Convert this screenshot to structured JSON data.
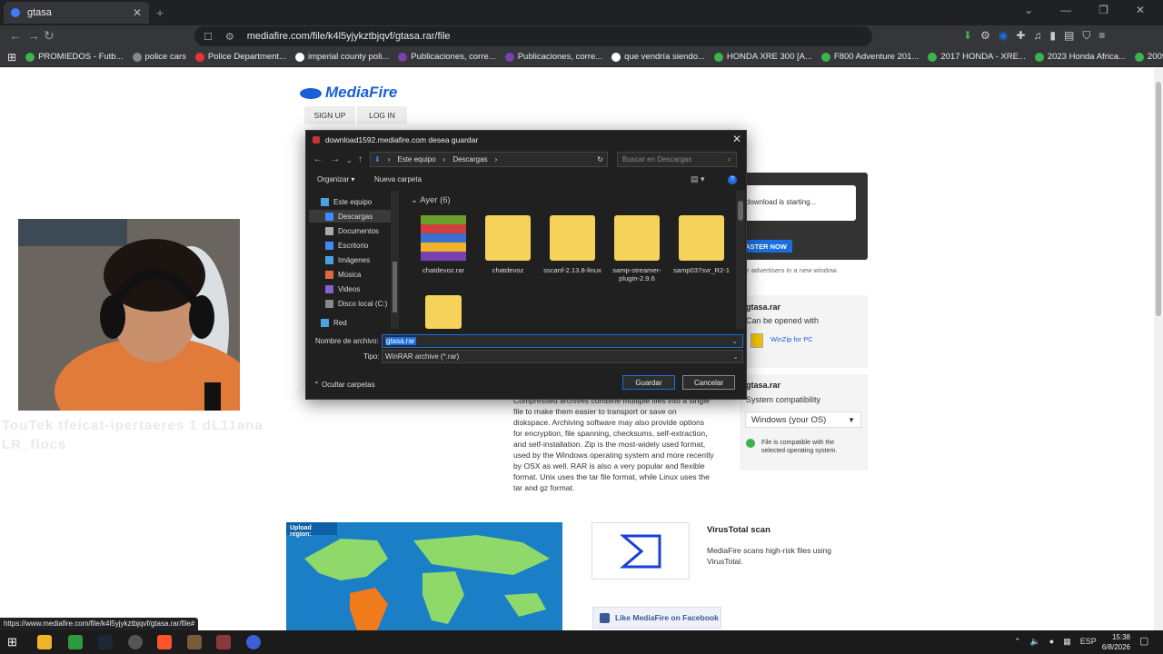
{
  "browser": {
    "tab_title": "gtasa",
    "url": "mediafire.com/file/k4l5yjykztbjqvf/gtasa.rar/file",
    "bookmarks": [
      "PROMIEDOS - Futb...",
      "police cars",
      "Police Department...",
      "imperial county poli...",
      "Publicaciones, corre...",
      "Publicaciones, corre...",
      "que vendría siendo...",
      "HONDA XRE 300 [A...",
      "F800 Adventure 201...",
      "2017 HONDA - XRE...",
      "2023 Honda Africa...",
      "2009 Honda CRF45..."
    ],
    "status_url": "https://www.mediafire.com/file/k4l5yjykztbjqvf/gtasa.rar/file#"
  },
  "page": {
    "logo": "MediaFire",
    "signup": "SIGN UP",
    "login": "LOG IN",
    "download_starting": "r download is starting...",
    "faster": "ASTER NOW",
    "advertisers": "ur advertisers in a new window.",
    "panel1_title": "gtasa.rar",
    "panel1_sub": "Can be opened with",
    "winzip": "WinZip for PC",
    "panel2_title": "gtasa.rar",
    "panel2_sub": "System compatibility",
    "os_select": "Windows (your OS)",
    "compat": "File is compatible with the selected operating system.",
    "description": "Compressed archives combine multiple files into a single file to make them easier to transport or save on diskspace. Archiving software may also provide options for encryption, file spanning, checksums, self-extraction, and self-installation. Zip is the most-widely used format, used by the Windows operating system and more recently by OSX as well. RAR is also a very popular and flexible format. Unix uses the tar file format, while Linux uses the tar and gz format.",
    "upload_region": "Upload region:",
    "virustotal_title": "VirusTotal scan",
    "virustotal_text": "MediaFire scans high-risk files using VirusTotal.",
    "facebook": "Like MediaFire on Facebook"
  },
  "webcam_overlay": "TouTek tfeicat-ipertaeres 1 dL11ana LR_flocs",
  "dialog": {
    "title": "download1592.mediafire.com desea guardar",
    "path": [
      "Este equipo",
      "Descargas"
    ],
    "search_placeholder": "Buscar en Descargas",
    "organize": "Organizar",
    "new_folder": "Nueva carpeta",
    "nav": [
      "Este equipo",
      "Descargas",
      "Documentos",
      "Escritorio",
      "Imágenes",
      "Música",
      "Videos",
      "Disco local (C:)",
      "Red"
    ],
    "group": "Ayer (6)",
    "files": [
      "chatdevoz.rar",
      "chatdevoz",
      "sscanf-2.13.8-linux",
      "samp-streamer-plugin-2.9.6",
      "samp037svr_R2-1",
      ""
    ],
    "filename_label": "Nombre de archivo:",
    "filename": "gtasa.rar",
    "type_label": "Tipo:",
    "type": "WinRAR archive (*.rar)",
    "hide_folders": "Ocultar carpetas",
    "save": "Guardar",
    "cancel": "Cancelar"
  },
  "taskbar": {
    "lang": "ESP",
    "time": "15:38",
    "date": "6/8/2026"
  }
}
